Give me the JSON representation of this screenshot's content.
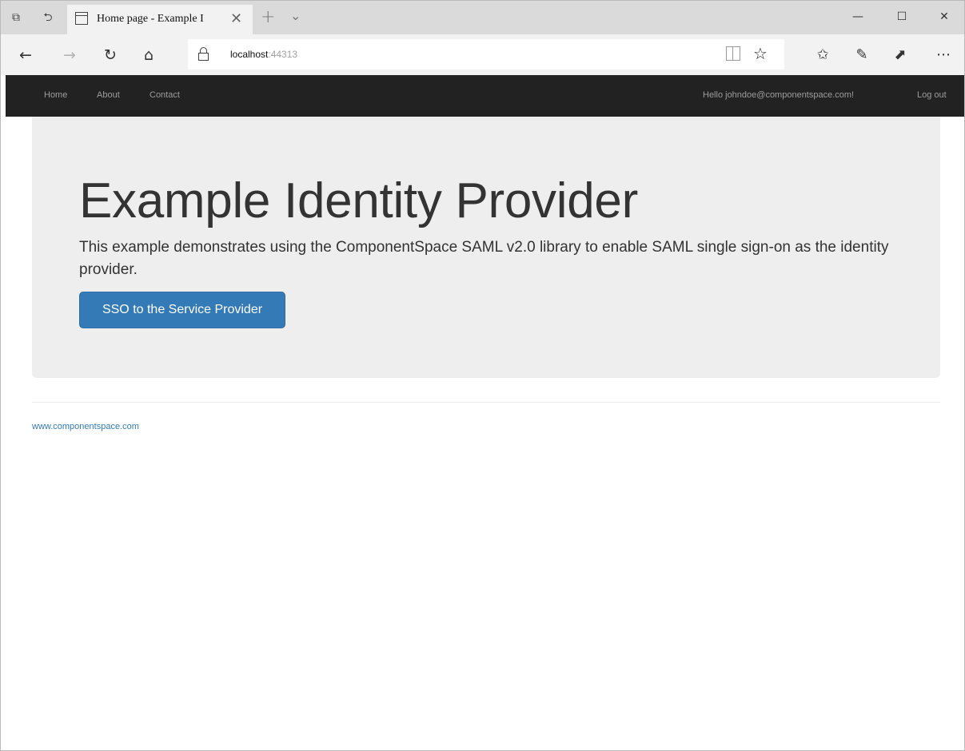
{
  "browser": {
    "tab": {
      "title": "Home page - Example I"
    },
    "address_bar": {
      "host": "localhost",
      "port": ":44313"
    },
    "icons": [
      "tab-list-icon",
      "tab-back-icon",
      "page-icon",
      "close-icon",
      "new-tab-icon",
      "chevron-down-icon",
      "minimize-icon",
      "maximize-icon",
      "window-close-icon",
      "back-icon",
      "forward-icon",
      "refresh-icon",
      "home-icon",
      "lock-icon",
      "reading-view-icon",
      "favorite-star-icon",
      "favorites-hub-icon",
      "pen-icon",
      "share-icon",
      "more-icon"
    ]
  },
  "site_nav": {
    "links": [
      "Home",
      "About",
      "Contact"
    ],
    "greeting": "Hello johndoe@componentspace.com!",
    "logout": "Log out"
  },
  "jumbotron": {
    "title": "Example Identity Provider",
    "text": "This example demonstrates using the ComponentSpace SAML v2.0 library to enable SAML single sign-on as the identity provider.",
    "button": "SSO to the Service Provider"
  },
  "footer": {
    "link": "www.componentspace.com"
  },
  "colors": {
    "navbar_bg": "#222222",
    "jumbotron_bg": "#eeeeee",
    "primary_button": "#337ab7",
    "link": "#337ab7"
  }
}
